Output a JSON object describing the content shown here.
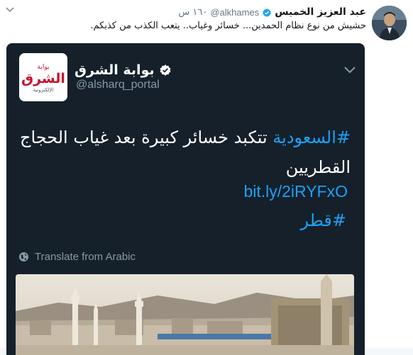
{
  "tweet": {
    "author_name": "عبد العزيز الخميس",
    "handle": "@alkhames",
    "time": "١٦٠ س",
    "text": "حشيش من نوع نظام الحمدين... خسائر وغياب.. يتعب الكذب من كذبكم."
  },
  "quoted": {
    "account_name": "بوابة الشرق",
    "handle": "@alsharq_portal",
    "logo_text": "الشرق",
    "logo_subtext": "بوابة",
    "logo_tagline": "الإلكترونية",
    "hashtag_1": "#السعودية",
    "text_rest": " تتكبد خسائر كبيرة بعد غياب الحجاج القطريين",
    "link": "bit.ly/2iRYFxO",
    "hashtag_2": "#قطر",
    "translate_label": "Translate from Arabic"
  },
  "colors": {
    "card_bg": "#15202b",
    "accent": "#1da1f2",
    "muted": "#8899a6",
    "logo_red": "#c8102e"
  },
  "icons": [
    "chevron-down-icon",
    "verified-badge-icon",
    "globe-icon"
  ]
}
